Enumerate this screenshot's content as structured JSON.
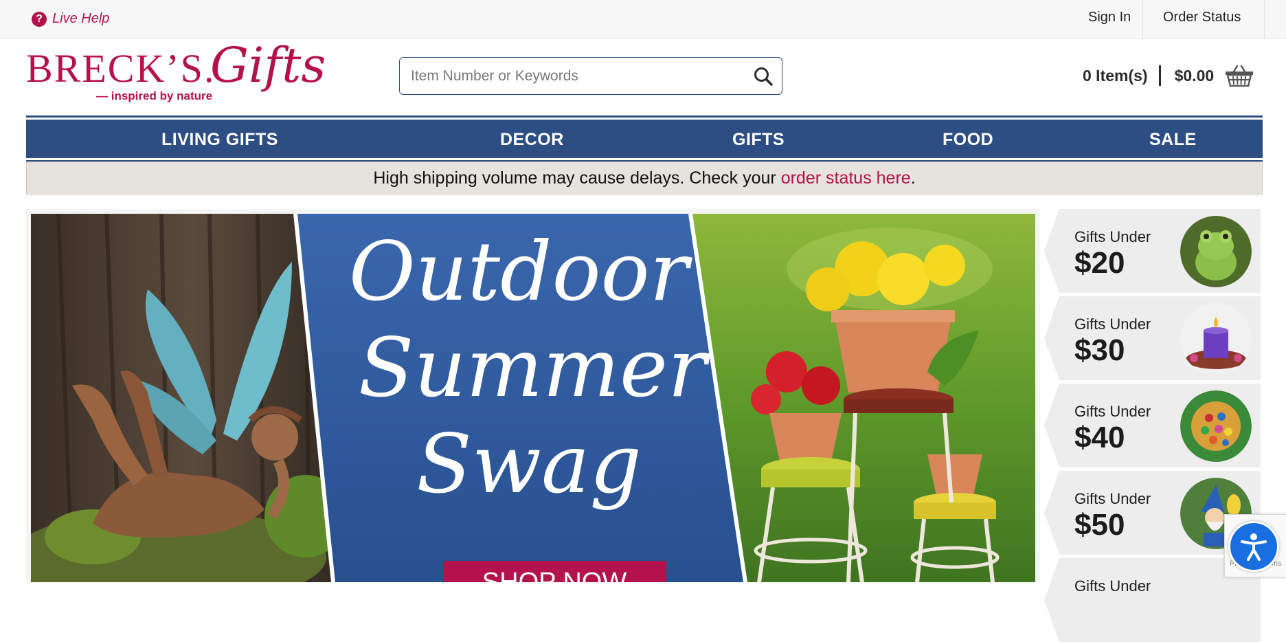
{
  "topbar": {
    "live_help": "Live Help",
    "sign_in": "Sign In",
    "order_status": "Order Status"
  },
  "logo": {
    "brand": "BRECK’S.",
    "gifts": "Gifts",
    "tagline": "— inspired by nature"
  },
  "search": {
    "placeholder": "Item Number or Keywords",
    "icon": "search-icon"
  },
  "cart": {
    "items": "0 Item(s)",
    "total": "$0.00",
    "icon": "basket-icon"
  },
  "nav": {
    "items": [
      {
        "label": "LIVING GIFTS"
      },
      {
        "label": "DECOR"
      },
      {
        "label": "GIFTS"
      },
      {
        "label": "FOOD"
      },
      {
        "label": "SALE"
      }
    ]
  },
  "notice": {
    "text": "High shipping volume may cause delays. Check your ",
    "link": "order status here",
    "end": "."
  },
  "hero": {
    "headline_1": "Outdoor",
    "headline_2": "Summer",
    "headline_3": "Swag",
    "cta": "SHOP NOW"
  },
  "price_cards": [
    {
      "label": "Gifts Under",
      "price": "$20"
    },
    {
      "label": "Gifts Under",
      "price": "$30"
    },
    {
      "label": "Gifts Under",
      "price": "$40"
    },
    {
      "label": "Gifts Under",
      "price": "$50"
    },
    {
      "label": "Gifts Under"
    }
  ],
  "recaptcha": {
    "text": "Privacy - Terms"
  },
  "colors": {
    "brand_magenta": "#b3124a",
    "nav_blue": "#2d4e82",
    "notice_bg": "#e6e2dd",
    "accessibility_blue": "#1a6fe0"
  }
}
